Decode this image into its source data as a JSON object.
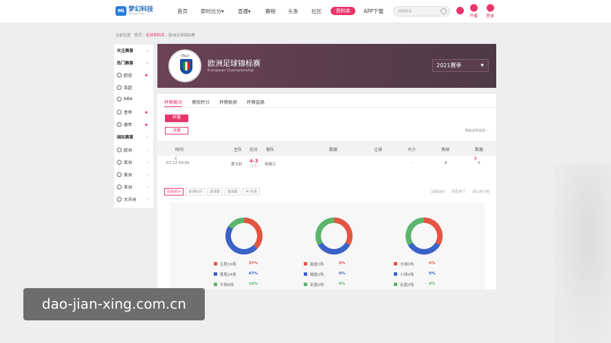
{
  "header": {
    "logo_mark": "Mi",
    "logo_name": "梦幻科技",
    "logo_sub": "MoHuan Tech",
    "nav": [
      "首页",
      "即时比分",
      "直播",
      "赛程",
      "头条",
      "社区",
      "资料库",
      "APP下载"
    ],
    "nav_dropdown_marks": [
      "▾",
      "▾"
    ],
    "search_placeholder": "搜索赛事",
    "kaibo_label": "开播",
    "login_label": "登录"
  },
  "breadcrumb": {
    "prefix": "当前位置",
    "home": "首页",
    "sep": "›",
    "library": "足球资料库",
    "current": "欧洲足球锦标赛"
  },
  "sidebar": {
    "chevron": "›",
    "star": "★",
    "items": [
      {
        "label": "关注赛事",
        "type": "head"
      },
      {
        "label": "热门赛事",
        "type": "head-open"
      },
      {
        "label": "欧冠",
        "type": "star"
      },
      {
        "label": "英超",
        "type": "plain"
      },
      {
        "label": "NBA",
        "type": "plain"
      },
      {
        "label": "意甲",
        "type": "star"
      },
      {
        "label": "德甲",
        "type": "star"
      },
      {
        "label": "国际赛事",
        "type": "head"
      },
      {
        "label": "欧洲",
        "type": "region"
      },
      {
        "label": "亚洲",
        "type": "region"
      },
      {
        "label": "美洲",
        "type": "region"
      },
      {
        "label": "非洲",
        "type": "region"
      },
      {
        "label": "大洋洲",
        "type": "region"
      }
    ]
  },
  "banner": {
    "emblem_text": "ITALIA",
    "title": "欧洲足球锦标赛",
    "subtitle": "European Championship",
    "season": "2021赛季",
    "season_arrow": "▼"
  },
  "tabs": [
    "杯赛概况",
    "赛程积分",
    "杯赛数据",
    "杯赛盘路"
  ],
  "stages": [
    "杯赛",
    "决赛"
  ],
  "rule_link": "赛制说明查看",
  "table": {
    "headers": [
      "时间",
      "主队",
      "比分",
      "客队",
      "数据",
      "让球",
      "大小",
      "角球",
      "数据"
    ],
    "row": {
      "time": "07-12 03:00",
      "home": "意大利",
      "score": "4-3",
      "half": "(1-1)",
      "away": "英格兰",
      "handicap": "",
      "ou": "-",
      "corner": "8",
      "data": "0"
    }
  },
  "stat_tabs": [
    "冠军统计",
    "进球时间",
    "进球数",
    "角球数",
    "半/全场"
  ],
  "stat_right": [
    "近期战绩",
    "球员排行",
    "球队排行榜"
  ],
  "arrows": {
    "left": "‹",
    "right": "›"
  },
  "chart_data": [
    {
      "type": "pie",
      "series": [
        {
          "name": "主胜19场",
          "value": 37,
          "label": "37%",
          "color": "#e35543"
        },
        {
          "name": "客胜24场",
          "value": 47,
          "label": "67%",
          "color": "#3a62c7"
        },
        {
          "name": "平局8场",
          "value": 16,
          "label": "16%",
          "color": "#5bb56b"
        }
      ]
    },
    {
      "type": "pie",
      "series": [
        {
          "name": "赢盘0场",
          "value": 33.3,
          "label": "0%",
          "color": "#e35543"
        },
        {
          "name": "输盘0场",
          "value": 33.3,
          "label": "0%",
          "color": "#3a62c7"
        },
        {
          "name": "走盘0场",
          "value": 33.3,
          "label": "0%",
          "color": "#5bb56b"
        }
      ]
    },
    {
      "type": "pie",
      "series": [
        {
          "name": "大球0场",
          "value": 33.3,
          "label": "0%",
          "color": "#e35543"
        },
        {
          "name": "小球0场",
          "value": 33.3,
          "label": "0%",
          "color": "#3a62c7"
        },
        {
          "name": "走盘0场",
          "value": 33.3,
          "label": "0%",
          "color": "#5bb56b"
        }
      ]
    }
  ],
  "watermark": "dao-jian-xing.com.cn"
}
